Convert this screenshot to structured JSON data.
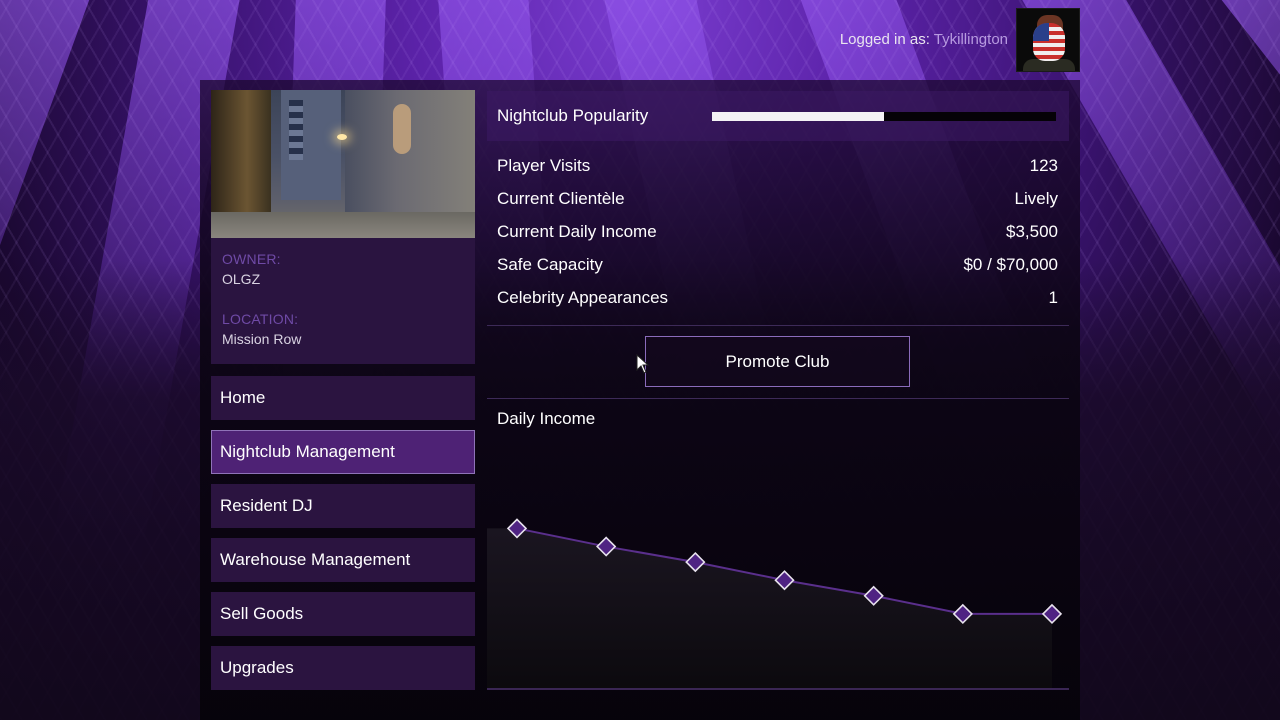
{
  "header": {
    "logged_in_label": "Logged in as:",
    "username": "Tykillington",
    "avatar": "player-avatar-flag-mask"
  },
  "property": {
    "owner_label": "OWNER:",
    "owner": "OLGZ",
    "location_label": "LOCATION:",
    "location": "Mission Row",
    "photo": "nightclub-alley-photo"
  },
  "menu": {
    "items": [
      {
        "label": "Home",
        "active": false
      },
      {
        "label": "Nightclub Management",
        "active": true
      },
      {
        "label": "Resident DJ",
        "active": false
      },
      {
        "label": "Warehouse Management",
        "active": false
      },
      {
        "label": "Sell Goods",
        "active": false
      },
      {
        "label": "Upgrades",
        "active": false
      }
    ]
  },
  "popularity": {
    "label": "Nightclub Popularity",
    "fraction": 0.5
  },
  "stats": [
    {
      "label": "Player Visits",
      "value": "123"
    },
    {
      "label": "Current Clientèle",
      "value": "Lively"
    },
    {
      "label": "Current Daily Income",
      "value": "$3,500"
    },
    {
      "label": "Safe Capacity",
      "value": "$0 / $70,000"
    },
    {
      "label": "Celebrity Appearances",
      "value": "1"
    }
  ],
  "actions": {
    "promote_label": "Promote Club"
  },
  "colors": {
    "accent": "#4e2275",
    "accent_border": "#8f73b8",
    "label_purple": "#6f4aa6",
    "username": "#b79ae0",
    "marker_fill": "#4f2383",
    "line": "#5a2f8c"
  },
  "chart_data": {
    "type": "line",
    "title": "Daily Income",
    "xlabel": "",
    "ylabel": "",
    "x": [
      1,
      2,
      3,
      4,
      5,
      6,
      7
    ],
    "values": [
      0.62,
      0.55,
      0.49,
      0.42,
      0.36,
      0.29,
      0.29
    ],
    "ylim": [
      0,
      1
    ],
    "grid": false,
    "legend": "none",
    "note": "relative values (no axis labels shown); monotonic decline then flat"
  }
}
